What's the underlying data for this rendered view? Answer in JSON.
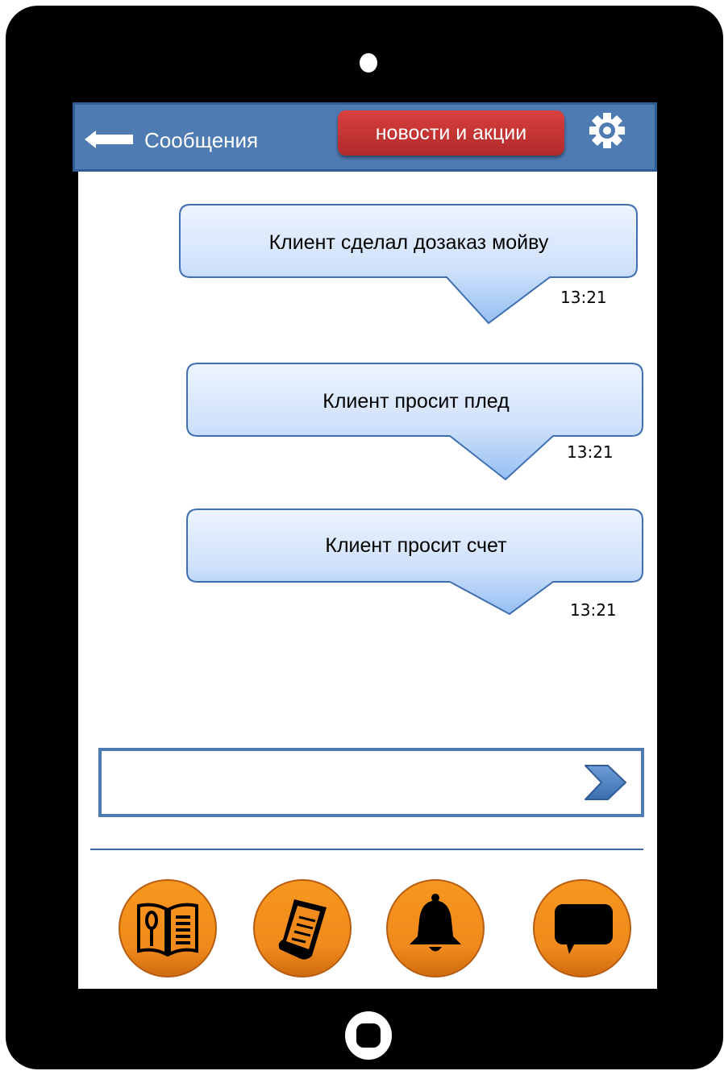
{
  "header": {
    "back_icon": "arrow-left-icon",
    "title": "Сообщения",
    "news_button": "новости и акции",
    "settings_icon": "gear-icon"
  },
  "messages": [
    {
      "text": "Клиент сделал дозаказ мойву",
      "time": "13:21"
    },
    {
      "text": "Клиент просит плед",
      "time": "13:21"
    },
    {
      "text": "Клиент просит счет",
      "time": "13:21"
    }
  ],
  "composer": {
    "placeholder": "",
    "value": "",
    "send_icon": "chevron-right-icon"
  },
  "bottom_nav": [
    {
      "icon": "menu-book-icon"
    },
    {
      "icon": "receipt-icon"
    },
    {
      "icon": "bell-icon"
    },
    {
      "icon": "chat-bubble-icon"
    }
  ],
  "colors": {
    "header_bg": "#4f7bb3",
    "news_button_bg": "#c0302f",
    "nav_button": "#f28a1f",
    "bubble_top": "#e9f2ff",
    "bubble_bottom": "#9cc3f3"
  }
}
